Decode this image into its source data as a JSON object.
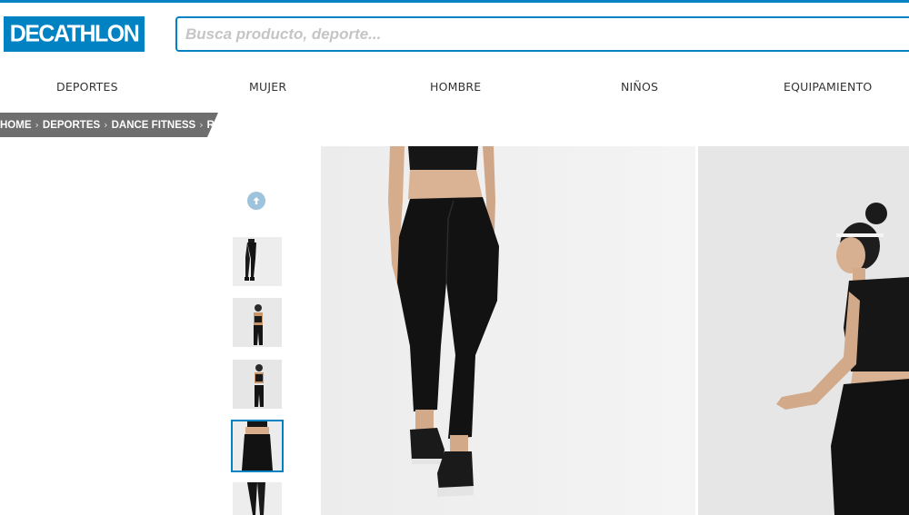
{
  "header": {
    "logo_text": "DECATHLON",
    "search_placeholder": "Busca producto, deporte..."
  },
  "nav": {
    "items": [
      "DEPORTES",
      "MUJER",
      "HOMBRE",
      "NIÑOS",
      "EQUIPAMIENTO"
    ]
  },
  "breadcrumb": {
    "items": [
      "HOME",
      "DEPORTES",
      "DANCE FITNESS",
      "ROPA"
    ]
  },
  "gallery": {
    "scroll_up_icon": "arrow-up-icon",
    "thumbnails": [
      {
        "subject": "leggings front"
      },
      {
        "subject": "model back view"
      },
      {
        "subject": "model front view"
      },
      {
        "subject": "leggings waist",
        "active": true
      },
      {
        "subject": "leggings legs"
      }
    ],
    "main_images": [
      "black high-waist leggings on model",
      "model in black sports outfit, side view"
    ]
  },
  "colors": {
    "brand": "#0082c3",
    "breadcrumb_bg": "#6e6e6e"
  }
}
